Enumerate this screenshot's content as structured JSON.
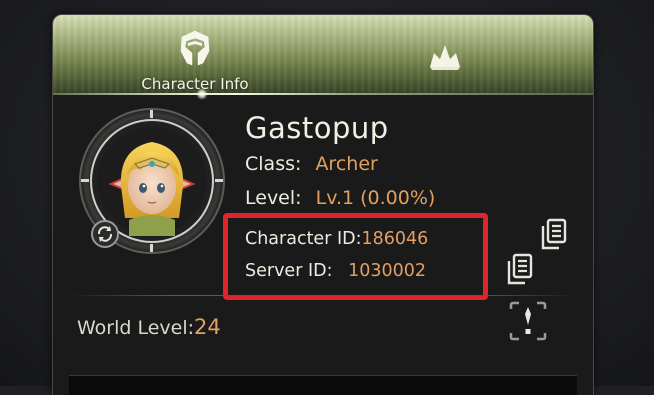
{
  "tabs": [
    {
      "label": "Character Info",
      "icon": "helmet-icon",
      "active": true
    },
    {
      "label": "",
      "icon": "crown-icon",
      "active": false
    }
  ],
  "character": {
    "name": "Gastopup",
    "class_label": "Class:",
    "class_value": "Archer",
    "level_label": "Level:",
    "level_value": "Lv.1 (0.00%)",
    "character_id_label": "Character ID:",
    "character_id_value": "186046",
    "server_id_label": "Server ID:",
    "server_id_value": "1030002"
  },
  "world": {
    "label": "World Level:",
    "value": "24"
  },
  "colors": {
    "accent_value": "#e0a060",
    "highlight_box": "#e0242c",
    "tab_green": "#8c9a62"
  }
}
